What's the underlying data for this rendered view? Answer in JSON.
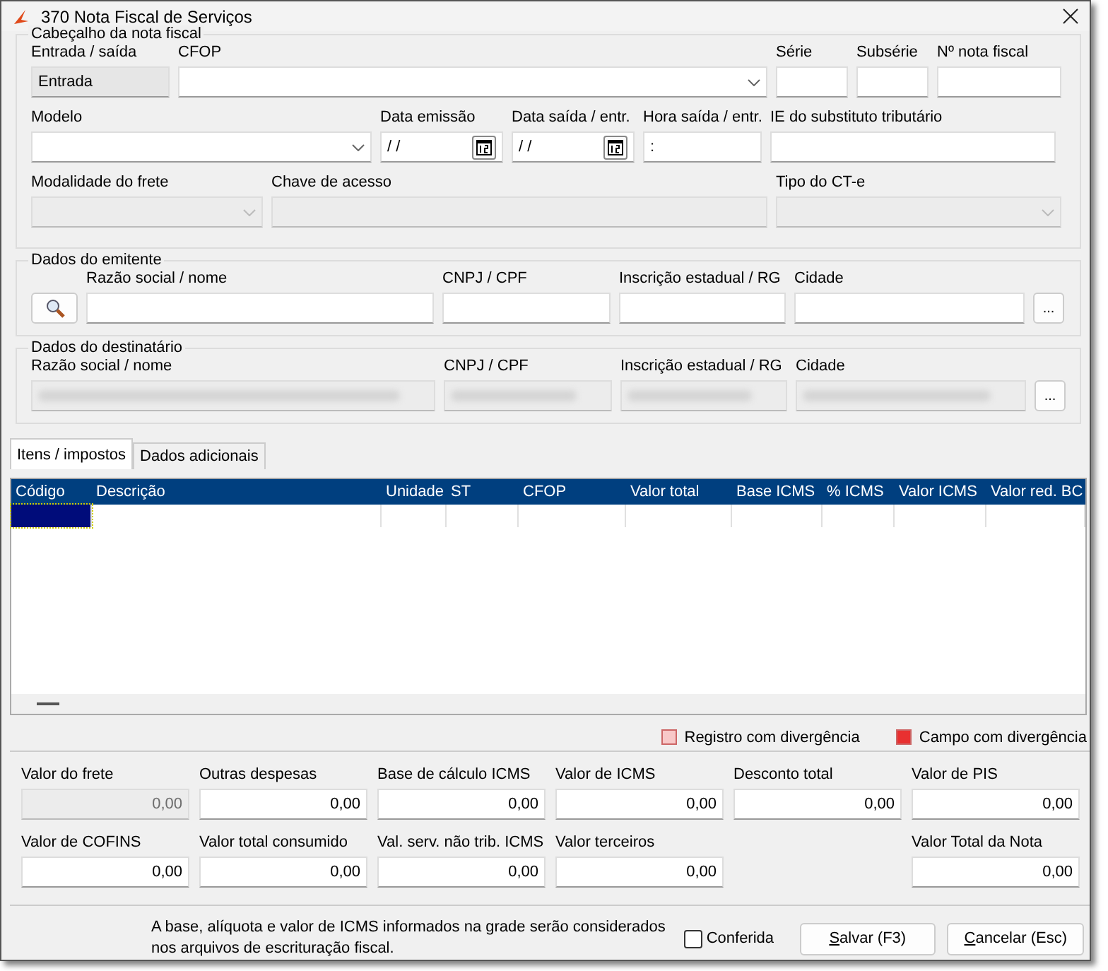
{
  "window": {
    "title": "370 Nota Fiscal de Serviços"
  },
  "header": {
    "title": "Cabeçalho da nota fiscal",
    "lines": [
      {
        "fields": [
          {
            "label": "Entrada / saída",
            "kind": "readonly",
            "value": "Entrada"
          },
          {
            "label": "CFOP",
            "kind": "select"
          },
          {
            "label": "Série",
            "kind": "text"
          },
          {
            "label": "Subsérie",
            "kind": "text"
          },
          {
            "label": "Nº nota fiscal",
            "kind": "text"
          }
        ]
      },
      {
        "fields": [
          {
            "label": "Modelo",
            "kind": "select"
          },
          {
            "label": "Data emissão",
            "kind": "date",
            "value": "/ /"
          },
          {
            "label": "Data saída / entr.",
            "kind": "date",
            "value": "/ /"
          },
          {
            "label": "Hora saída / entr.",
            "kind": "text",
            "value": ":"
          },
          {
            "label": "IE do substituto tributário",
            "kind": "text"
          }
        ]
      },
      {
        "fields": [
          {
            "label": "Modalidade do frete",
            "kind": "select",
            "disabled": true
          },
          {
            "label": "Chave de acesso",
            "kind": "text",
            "disabled": true
          },
          {
            "label": "Tipo do CT-e",
            "kind": "select",
            "disabled": true
          }
        ]
      }
    ]
  },
  "emitente": {
    "title": "Dados do emitente",
    "fields": [
      {
        "label": "Razão social / nome",
        "redacted": false
      },
      {
        "label": "CNPJ / CPF",
        "redacted": false
      },
      {
        "label": "Inscrição estadual / RG",
        "redacted": false
      },
      {
        "label": "Cidade",
        "redacted": false
      }
    ],
    "browse_button": "..."
  },
  "destinatario": {
    "title": "Dados do destinatário",
    "fields": [
      {
        "label": "Razão social / nome",
        "redacted": true
      },
      {
        "label": "CNPJ / CPF",
        "redacted": true
      },
      {
        "label": "Inscrição estadual / RG",
        "redacted": true
      },
      {
        "label": "Cidade",
        "redacted": true
      }
    ],
    "browse_button": "..."
  },
  "tabs": [
    {
      "label": "Itens / impostos",
      "selected": true
    },
    {
      "label": "Dados adicionais",
      "selected": false
    }
  ],
  "table": {
    "columns": [
      "Código",
      "Descrição",
      "Unidade",
      "ST",
      "CFOP",
      "Valor total",
      "Base ICMS",
      "% ICMS",
      "Valor ICMS",
      "Valor red. BC"
    ],
    "rows": [
      {
        "selected": true
      }
    ]
  },
  "legend": [
    {
      "label": "Registro com divergência",
      "color": "#f8c8c8"
    },
    {
      "label": "Campo com divergência",
      "color": "#e83030"
    }
  ],
  "totals": [
    {
      "fields": [
        {
          "label": "Valor do frete",
          "value": "0,00",
          "disabled": true
        },
        {
          "label": "Outras despesas",
          "value": "0,00",
          "disabled": false
        },
        {
          "label": "Base de cálculo ICMS",
          "value": "0,00",
          "disabled": false
        },
        {
          "label": "Valor de ICMS",
          "value": "0,00",
          "disabled": false
        },
        {
          "label": "Desconto total",
          "value": "0,00",
          "disabled": false
        },
        {
          "label": "Valor de PIS",
          "value": "0,00",
          "disabled": false
        }
      ]
    },
    {
      "fields": [
        {
          "label": "Valor de COFINS",
          "value": "0,00",
          "disabled": false
        },
        {
          "label": "Valor total consumido",
          "value": "0,00",
          "disabled": false
        },
        {
          "label": "Val. serv. não trib. ICMS",
          "value": "0,00",
          "disabled": false
        },
        {
          "label": "Valor terceiros",
          "value": "0,00",
          "disabled": false
        },
        {
          "kind": "empty"
        },
        {
          "label": "Valor Total da Nota",
          "value": "0,00",
          "disabled": false
        }
      ]
    }
  ],
  "footer": {
    "note": "A base, alíquota e valor de ICMS informados na grade serão considerados nos arquivos de escrituração fiscal.",
    "checkbox": {
      "label": "Conferida",
      "checked": false
    },
    "buttons": [
      "Salvar (F3)",
      "Cancelar (Esc)"
    ]
  }
}
